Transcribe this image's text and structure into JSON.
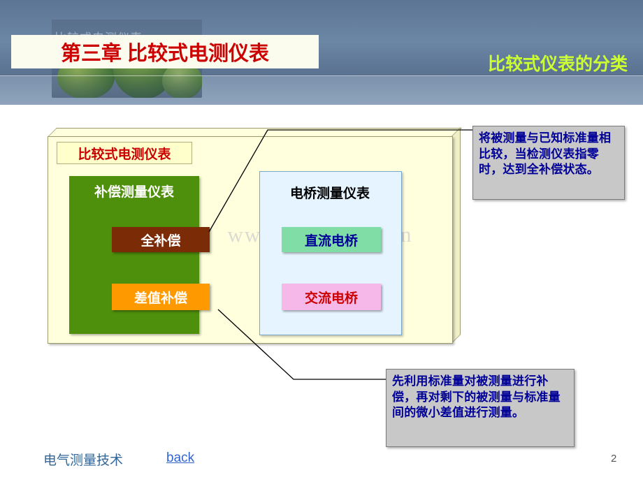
{
  "header": {
    "chapter_title": "第三章 比较式电测仪表",
    "subtitle": "比较式仪表的分类",
    "ghost_text": "比较式电测仪表"
  },
  "diagram": {
    "outer_label": "比较式电测仪表",
    "left_group": {
      "title": "补偿测量仪表",
      "items": [
        {
          "label": "全补偿"
        },
        {
          "label": "差值补偿"
        }
      ]
    },
    "right_group": {
      "title": "电桥测量仪表",
      "items": [
        {
          "label": "直流电桥"
        },
        {
          "label": "交流电桥"
        }
      ]
    }
  },
  "callouts": [
    {
      "text": "将被测量与已知标准量相比较，当检测仪表指零时，达到全补偿状态。"
    },
    {
      "text": "先利用标准量对被测量进行补偿，再对剩下的被测量与标准量间的微小差值进行测量。"
    }
  ],
  "watermark": "www.zixin.com.cn",
  "footer": {
    "course": "电气测量技术",
    "back_link": "back",
    "page_number": "2"
  }
}
